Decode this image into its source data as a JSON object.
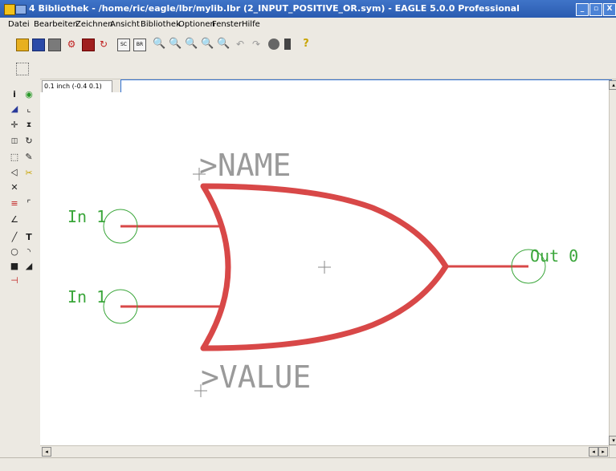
{
  "window": {
    "title": "4 Bibliothek - /home/ric/eagle/lbr/mylib.lbr (2_INPUT_POSITIVE_OR.sym) - EAGLE 5.0.0 Professional",
    "controls": [
      "_",
      "▫",
      "X"
    ]
  },
  "menu": [
    "Datei",
    "Bearbeiten",
    "Zeichnen",
    "Ansicht",
    "Bibliothek",
    "Optionen",
    "Fenster",
    "Hilfe"
  ],
  "coord": "0.1 inch (-0.4 0.1)",
  "command": "",
  "symbol": {
    "name_label": ">NAME",
    "value_label": ">VALUE",
    "pin_in1": "In 1",
    "pin_in2": "In 1",
    "pin_out": "Out 0"
  },
  "colors": {
    "gate": "#d84848",
    "pin_text": "#3aa63a",
    "label_text": "#9a9a9a",
    "title_bg": "#2a5bb0"
  }
}
